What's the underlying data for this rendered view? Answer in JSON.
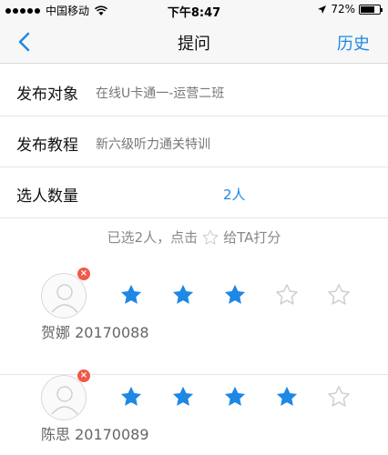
{
  "status_bar": {
    "carrier": "中国移动",
    "time": "下午8:47",
    "battery": "72%",
    "battery_level": 0.72
  },
  "nav": {
    "title": "提问",
    "history_label": "历史"
  },
  "form": {
    "target_label": "发布对象",
    "target_value": "在线U卡通一-运营二班",
    "course_label": "发布教程",
    "course_value": "新六级听力通关特训",
    "count_label": "选人数量",
    "count_value": "2人"
  },
  "hint": {
    "before": "已选2人，点击",
    "after": "给TA打分"
  },
  "students": [
    {
      "name": "贺娜 20170088",
      "rating": 3,
      "max": 5
    },
    {
      "name": "陈思 20170089",
      "rating": 4,
      "max": 5
    }
  ],
  "colors": {
    "accent": "#1e88e5",
    "star_filled": "#1e88e5",
    "star_empty": "#cfcfcf",
    "remove_badge": "#f05a4a"
  }
}
